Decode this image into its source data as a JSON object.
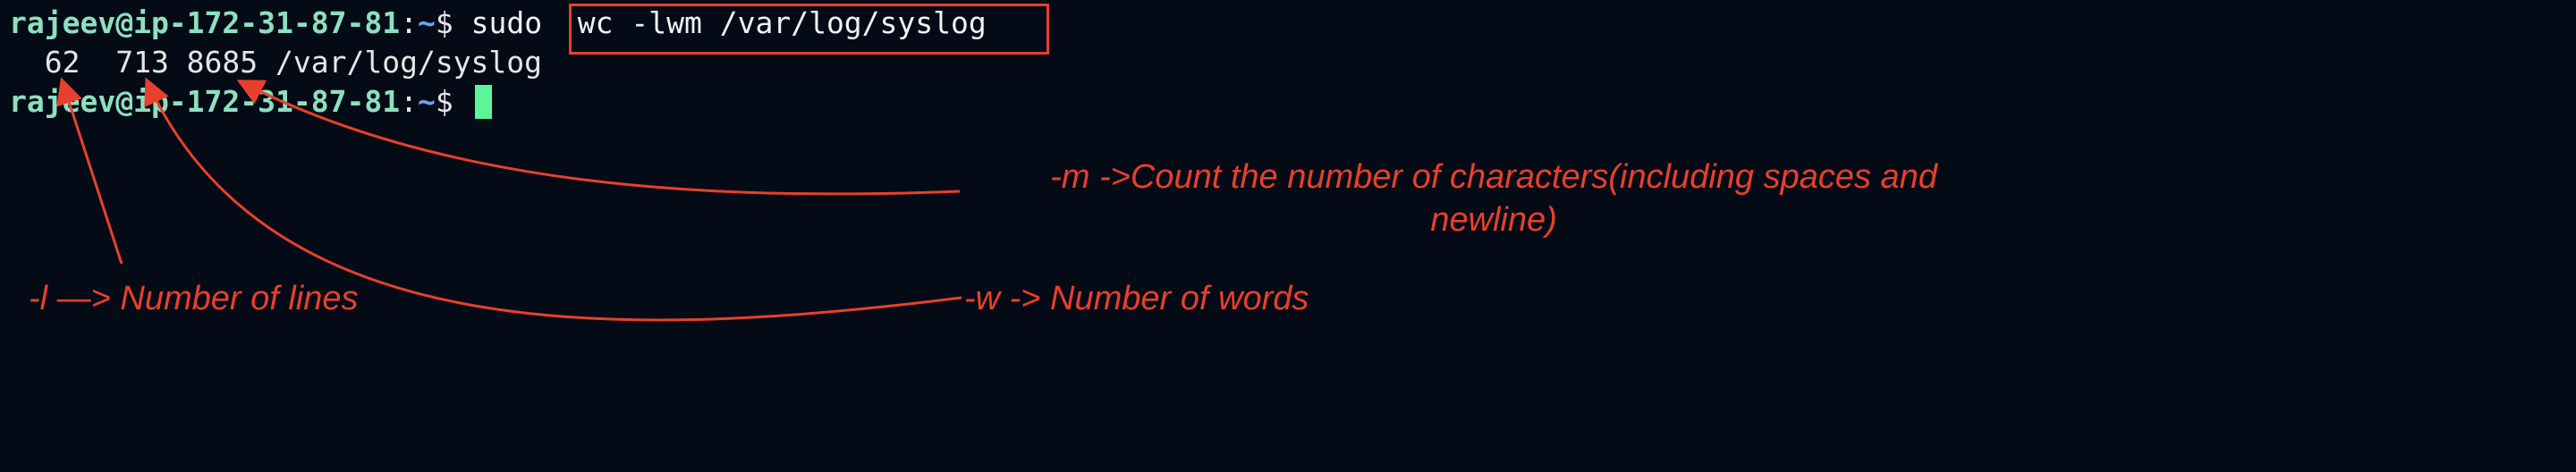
{
  "terminal": {
    "prompt_user_host": "rajeev@ip-172-31-87-81",
    "prompt_colon": ":",
    "prompt_path": "~",
    "prompt_symbol": "$",
    "sudo": " sudo  ",
    "command": "wc -lwm /var/log/syslog",
    "output": "  62  713 8685 /var/log/syslog"
  },
  "annotations": {
    "lines": "-l —> Number of lines",
    "words": "-w -> Number of words",
    "chars": "-m ->Count the number of characters(including spaces and newline)"
  },
  "colors": {
    "background": "#050b16",
    "prompt_user": "#8de0c0",
    "prompt_path": "#6aa4ff",
    "cursor": "#5cf59a",
    "annotation": "#e8402c"
  }
}
